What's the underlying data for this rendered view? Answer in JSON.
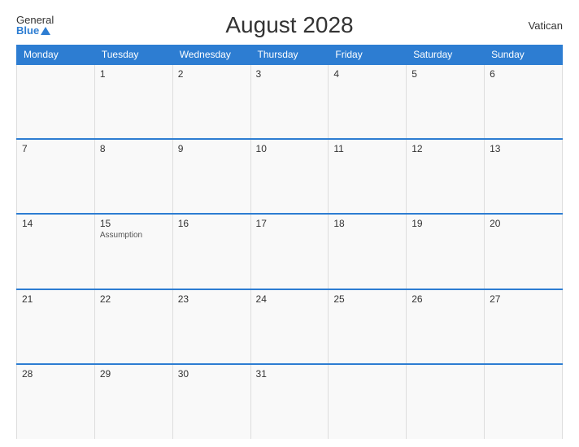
{
  "header": {
    "title": "August 2028",
    "logo_general": "General",
    "logo_blue": "Blue",
    "country": "Vatican"
  },
  "weekdays": [
    "Monday",
    "Tuesday",
    "Wednesday",
    "Thursday",
    "Friday",
    "Saturday",
    "Sunday"
  ],
  "weeks": [
    [
      {
        "day": "",
        "holiday": ""
      },
      {
        "day": "1",
        "holiday": ""
      },
      {
        "day": "2",
        "holiday": ""
      },
      {
        "day": "3",
        "holiday": ""
      },
      {
        "day": "4",
        "holiday": ""
      },
      {
        "day": "5",
        "holiday": ""
      },
      {
        "day": "6",
        "holiday": ""
      }
    ],
    [
      {
        "day": "7",
        "holiday": ""
      },
      {
        "day": "8",
        "holiday": ""
      },
      {
        "day": "9",
        "holiday": ""
      },
      {
        "day": "10",
        "holiday": ""
      },
      {
        "day": "11",
        "holiday": ""
      },
      {
        "day": "12",
        "holiday": ""
      },
      {
        "day": "13",
        "holiday": ""
      }
    ],
    [
      {
        "day": "14",
        "holiday": ""
      },
      {
        "day": "15",
        "holiday": "Assumption"
      },
      {
        "day": "16",
        "holiday": ""
      },
      {
        "day": "17",
        "holiday": ""
      },
      {
        "day": "18",
        "holiday": ""
      },
      {
        "day": "19",
        "holiday": ""
      },
      {
        "day": "20",
        "holiday": ""
      }
    ],
    [
      {
        "day": "21",
        "holiday": ""
      },
      {
        "day": "22",
        "holiday": ""
      },
      {
        "day": "23",
        "holiday": ""
      },
      {
        "day": "24",
        "holiday": ""
      },
      {
        "day": "25",
        "holiday": ""
      },
      {
        "day": "26",
        "holiday": ""
      },
      {
        "day": "27",
        "holiday": ""
      }
    ],
    [
      {
        "day": "28",
        "holiday": ""
      },
      {
        "day": "29",
        "holiday": ""
      },
      {
        "day": "30",
        "holiday": ""
      },
      {
        "day": "31",
        "holiday": ""
      },
      {
        "day": "",
        "holiday": ""
      },
      {
        "day": "",
        "holiday": ""
      },
      {
        "day": "",
        "holiday": ""
      }
    ]
  ]
}
